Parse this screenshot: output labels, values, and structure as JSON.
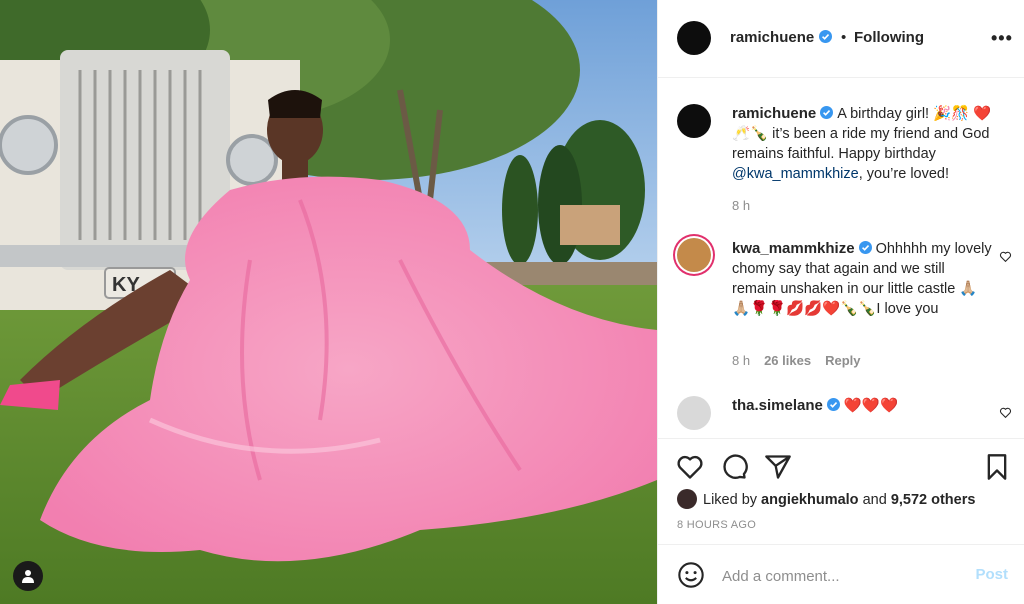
{
  "post": {
    "author": "ramichuene",
    "separator": "•",
    "follow_status": "Following",
    "more_label": "•••",
    "photo_plate_text": "KY"
  },
  "comments": [
    {
      "username": "ramichuene",
      "text_a": "A birthday girl! 🎉🎊",
      "text_b": "❤️🥂🍾 it’s been a ride my friend and God remains faithful. Happy birthday",
      "mention": "@kwa_mammkhize",
      "text_c": ", you’re loved!",
      "time": "8 h"
    },
    {
      "username": "kwa_mammkhize",
      "text": "Ohhhhh my lovely chomy say that again and we still remain unshaken in our little castle 🙏🏼🙏🏼🌹🌹💋💋❤️🍾🍾I love you",
      "time": "8 h",
      "likes": "26 likes",
      "reply": "Reply"
    },
    {
      "username": "tha.simelane",
      "text": "❤️❤️❤️"
    }
  ],
  "likes": {
    "prefix": "Liked by",
    "user": "angiekhumalo",
    "and": "and",
    "others": "9,572 others"
  },
  "timestamp": "8 HOURS AGO",
  "add_comment": {
    "placeholder": "Add a comment...",
    "post_label": "Post"
  },
  "colors": {
    "verified": "#3897f0",
    "link": "#00376b",
    "post_disabled": "#b2dffc"
  }
}
